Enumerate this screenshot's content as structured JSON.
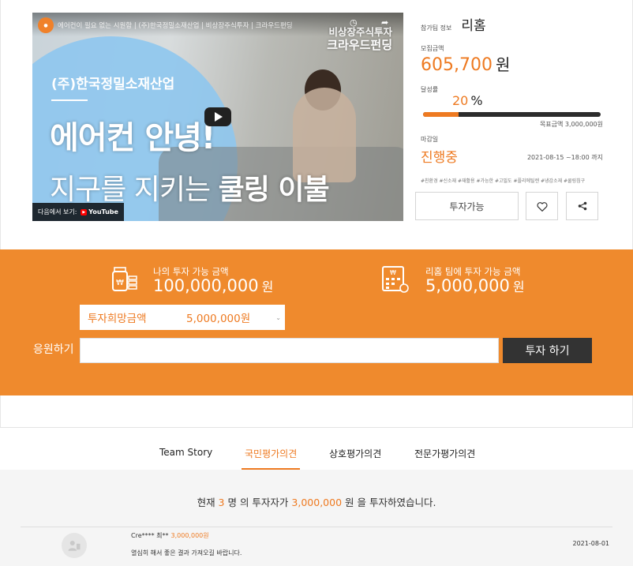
{
  "video": {
    "channel_logo": "crowdfunding-logo",
    "title": "에어컨이 필요 없는 시원함 | (주)한국정밀소재산업 | 비상장주식투자 | 크라우드펀딩",
    "brand_line1": "비상장주식투자",
    "brand_line2": "크라우드펀딩",
    "company": "(주)한국정밀소재산업",
    "headline1": "에어컨 안녕!",
    "headline2_a": "지구를 지키는 ",
    "headline2_b": "쿨링 이불",
    "watch_on": "다음에서 보기:",
    "youtube": "YouTube"
  },
  "project": {
    "team_label": "참가팀 정보",
    "team_name": "리홈",
    "raised_label": "모집금액",
    "raised_amount": "605,700",
    "raised_unit": "원",
    "achieve_label": "달성률",
    "achieve_value": "20",
    "achieve_unit": "%",
    "achieve_fraction": 0.2,
    "target": "목표금액 3,000,000원",
    "deadline_label": "마감일",
    "status": "진행중",
    "deadline": "2021-08-15 ~18:00 까지",
    "tags": "#친환경 #신소재 #재활용 #가능한 #고밀도 #플리에틸렌 #냉감소재 #쿨링침구",
    "invest_status_btn": "투자가능"
  },
  "invest": {
    "my_label": "나의 투자 가능 금액",
    "my_amount": "100,000,000",
    "team_label": "리홈 팀에 투자 가능 금액",
    "team_amount": "5,000,000",
    "unit": "원",
    "select_label": "투자희망금액",
    "select_value": "5,000,000원",
    "apply_label": "응원하기",
    "submit": "투자 하기"
  },
  "tabs": [
    "Team Story",
    "국민평가의견",
    "상호평가의견",
    "전문가평가의견"
  ],
  "summary": {
    "p1": "현재 ",
    "investors": "3",
    "p2": " 명 의 투자자가 ",
    "amount": "3,000,000",
    "p3": " 원 을 투자하였습니다."
  },
  "comment": {
    "author": "Cre**** 최**",
    "amount": "3,000,000원",
    "text": "열심히 해서 좋은 결과 가져오길 바랍니다.",
    "date": "2021-08-01"
  },
  "colors": {
    "accent": "#ee7a21",
    "panel": "#ef8a2d",
    "dark": "#333333"
  }
}
